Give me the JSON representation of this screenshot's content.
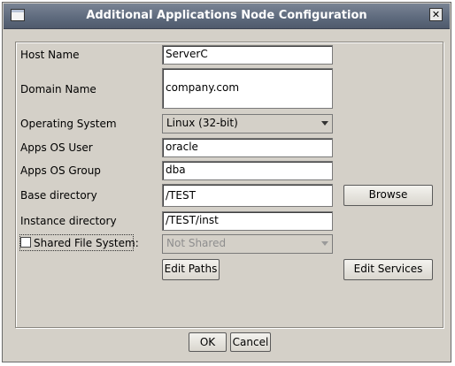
{
  "window": {
    "title": "Additional Applications Node Configuration",
    "close_glyph": "✕"
  },
  "form": {
    "host_name_label": "Host Name",
    "host_name_value": "ServerC",
    "domain_name_label": "Domain Name",
    "domain_name_value": "company.com",
    "os_label": "Operating System",
    "os_value": "Linux (32-bit)",
    "apps_os_user_label": "Apps OS User",
    "apps_os_user_value": "oracle",
    "apps_os_group_label": "Apps OS Group",
    "apps_os_group_value": "dba",
    "base_dir_label": "Base directory",
    "base_dir_value": "/TEST",
    "instance_dir_label": "Instance directory",
    "instance_dir_value": "/TEST/inst",
    "shared_fs_label": "Shared File System:",
    "shared_fs_checked": false,
    "shared_fs_value": "Not Shared"
  },
  "buttons": {
    "browse": "Browse",
    "edit_paths": "Edit Paths",
    "edit_services": "Edit Services",
    "ok": "OK",
    "cancel": "Cancel"
  }
}
